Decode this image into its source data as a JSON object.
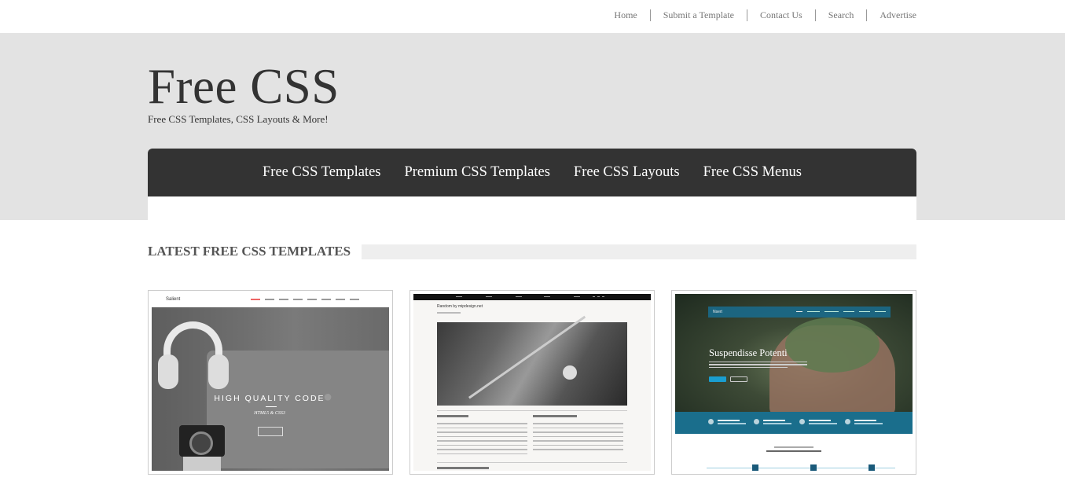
{
  "top_nav": {
    "items": [
      "Home",
      "Submit a Template",
      "Contact Us",
      "Search",
      "Advertise"
    ]
  },
  "header": {
    "site_title": "Free CSS",
    "tagline": "Free CSS Templates, CSS Layouts & More!"
  },
  "main_nav": {
    "items": [
      "Free CSS Templates",
      "Premium CSS Templates",
      "Free CSS Layouts",
      "Free CSS Menus"
    ]
  },
  "section": {
    "heading": "LATEST FREE CSS TEMPLATES"
  },
  "cards": [
    {
      "logo": "Salient",
      "hero_title": "HIGH QUALITY CODE",
      "hero_subtitle": "HTML5 & CSS3"
    },
    {
      "title": "Random by mipdesign.net"
    },
    {
      "logo": "Nsert",
      "hero_title": "Suspendisse Potenti"
    }
  ],
  "colors": {
    "header_bg": "#e3e3e3",
    "nav_bg": "#333333",
    "accent_teal": "#1a6e8c"
  }
}
